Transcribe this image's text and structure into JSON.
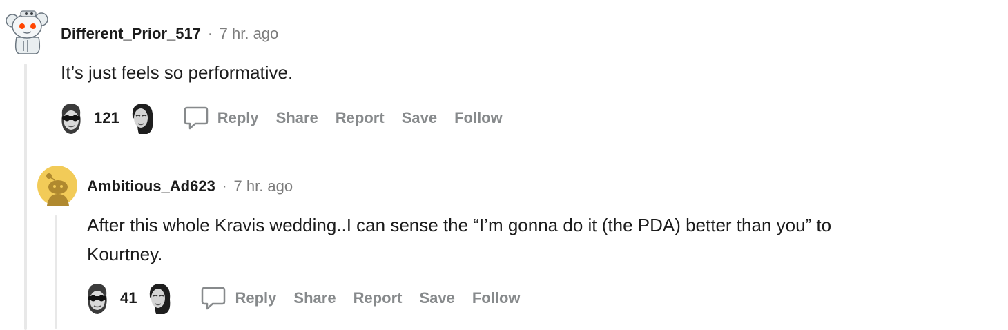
{
  "comments": [
    {
      "username": "Different_Prior_517",
      "separator": "·",
      "time": "7 hr. ago",
      "body": "It’s just feels so performative.",
      "score": "121",
      "actions": {
        "reply": "Reply",
        "share": "Share",
        "report": "Report",
        "save": "Save",
        "follow": "Follow"
      },
      "avatar_icon": "snoo-avatar-icon"
    },
    {
      "username": "Ambitious_Ad623",
      "separator": "·",
      "time": "7 hr. ago",
      "body_line1": "After this whole Kravis wedding..I can sense the “I’m gonna do it (the PDA) better than you” to",
      "body_line2": "Kourtney.",
      "score": "41",
      "actions": {
        "reply": "Reply",
        "share": "Share",
        "report": "Report",
        "save": "Save",
        "follow": "Follow"
      },
      "avatar_icon": "default-snoo-avatar-icon"
    }
  ],
  "colors": {
    "text": "#1c1c1c",
    "muted": "#878a8c",
    "thread_line": "#e8e8e8",
    "default_avatar_bg": "#f2cb58"
  }
}
